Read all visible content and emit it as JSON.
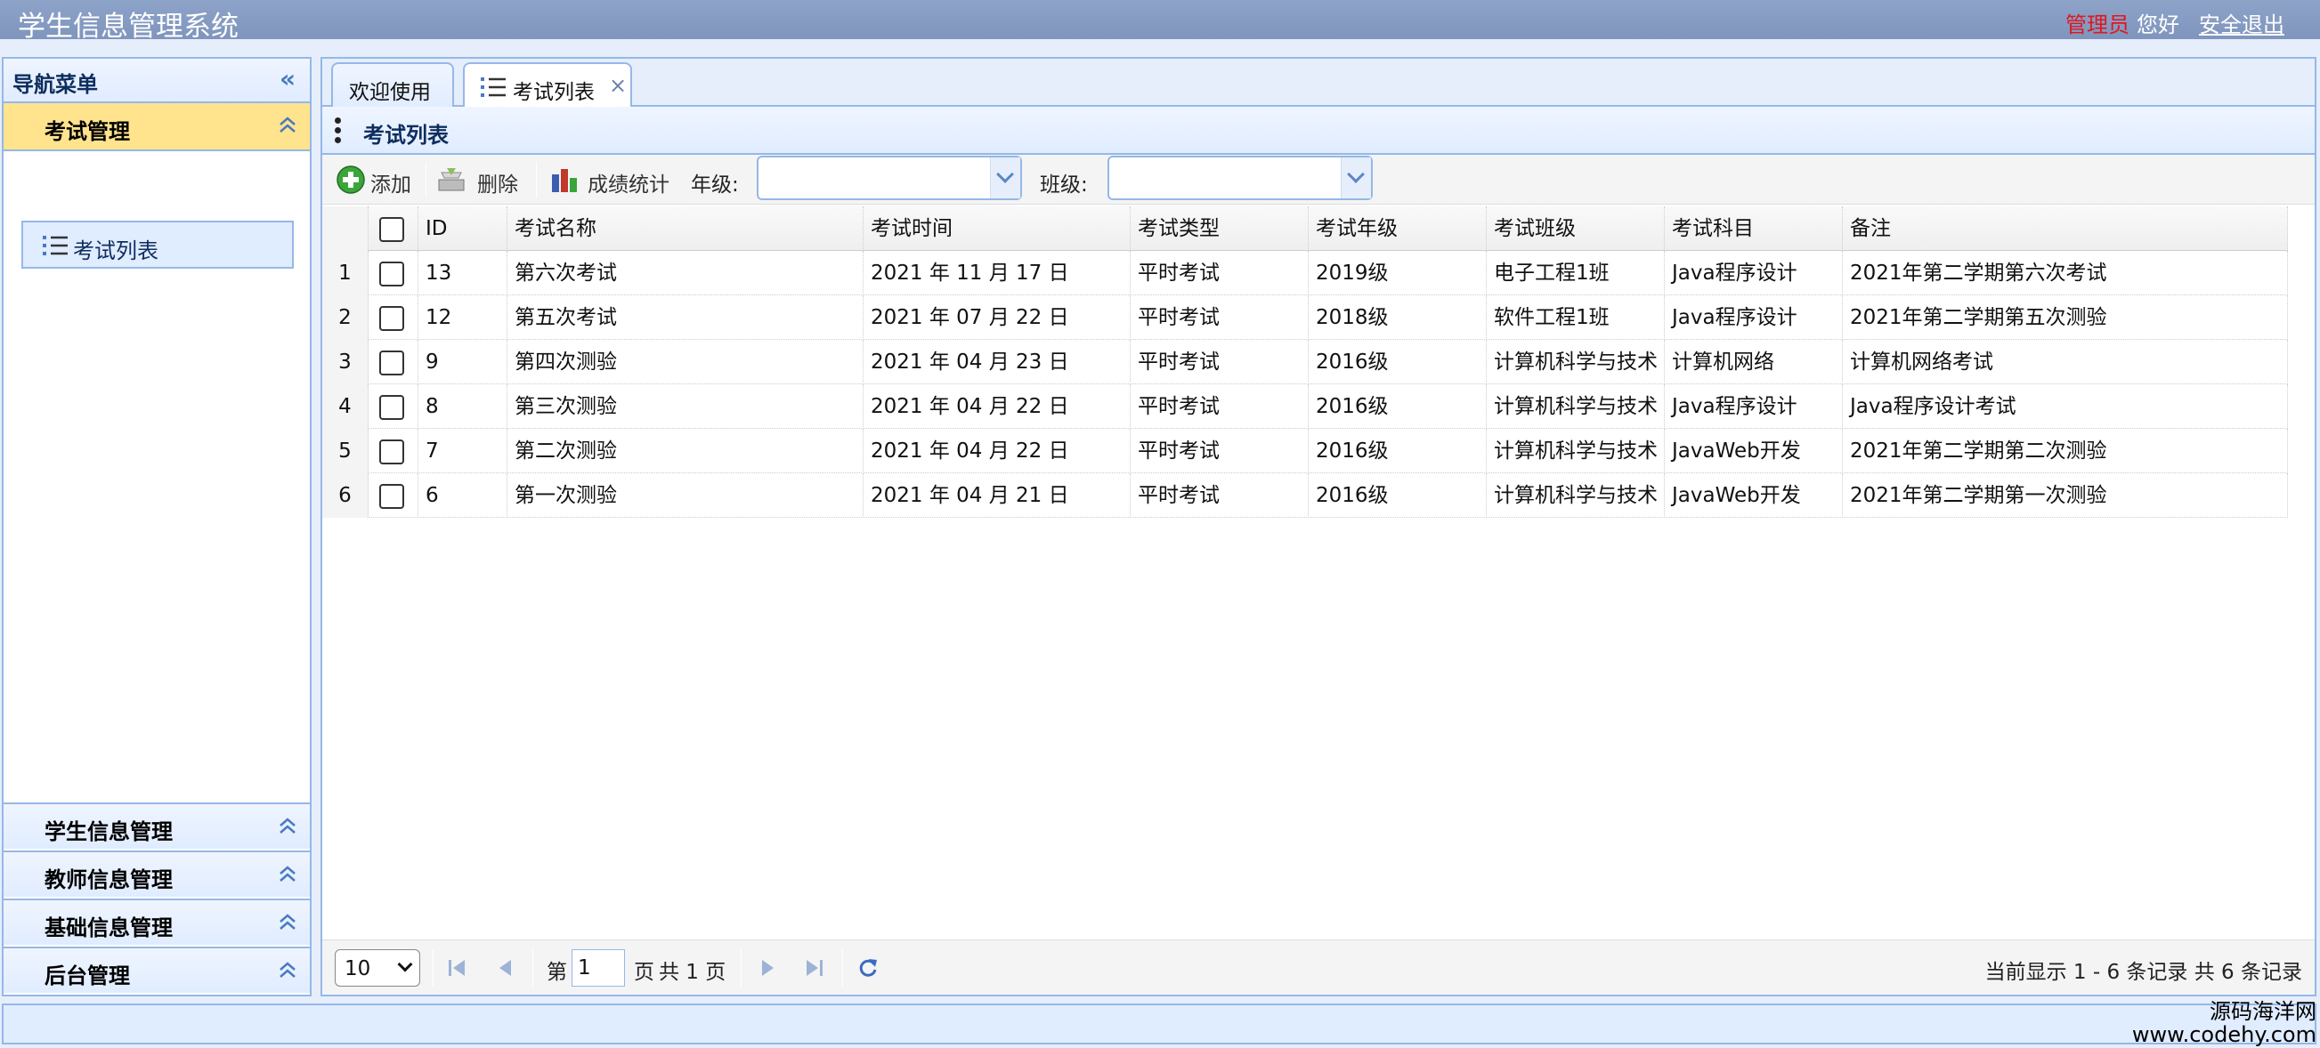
{
  "header": {
    "title": "学生信息管理系统",
    "user_role": "管理员",
    "greeting": "您好",
    "logout_label": "安全退出"
  },
  "nav": {
    "title": "导航菜单",
    "active_section": "考试管理",
    "active_items": [
      "考试列表"
    ],
    "sections": [
      "学生信息管理",
      "教师信息管理",
      "基础信息管理",
      "后台管理"
    ]
  },
  "tabs": [
    {
      "label": "欢迎使用",
      "active": false
    },
    {
      "label": "考试列表",
      "active": true,
      "closable": true,
      "close_glyph": "×"
    }
  ],
  "panel": {
    "title": "考试列表"
  },
  "toolbar": {
    "add_label": "添加",
    "delete_label": "删除",
    "stats_label": "成绩统计",
    "grade_label": "年级:",
    "class_label": "班级:",
    "grade_value": "",
    "class_value": ""
  },
  "grid": {
    "columns": [
      "ID",
      "考试名称",
      "考试时间",
      "考试类型",
      "考试年级",
      "考试班级",
      "考试科目",
      "备注"
    ],
    "rows": [
      {
        "num": "1",
        "cells": [
          "13",
          "第六次考试",
          "2021 年 11 月 17 日",
          "平时考试",
          "2019级",
          "电子工程1班",
          "Java程序设计",
          "2021年第二学期第六次考试"
        ]
      },
      {
        "num": "2",
        "cells": [
          "12",
          "第五次考试",
          "2021 年 07 月 22 日",
          "平时考试",
          "2018级",
          "软件工程1班",
          "Java程序设计",
          "2021年第二学期第五次测验"
        ]
      },
      {
        "num": "3",
        "cells": [
          "9",
          "第四次测验",
          "2021 年 04 月 23 日",
          "平时考试",
          "2016级",
          "计算机科学与技术",
          "计算机网络",
          "计算机网络考试"
        ]
      },
      {
        "num": "4",
        "cells": [
          "8",
          "第三次测验",
          "2021 年 04 月 22 日",
          "平时考试",
          "2016级",
          "计算机科学与技术",
          "Java程序设计",
          "Java程序设计考试"
        ]
      },
      {
        "num": "5",
        "cells": [
          "7",
          "第二次测验",
          "2021 年 04 月 22 日",
          "平时考试",
          "2016级",
          "计算机科学与技术",
          "JavaWeb开发",
          "2021年第二学期第二次测验"
        ]
      },
      {
        "num": "6",
        "cells": [
          "6",
          "第一次测验",
          "2021 年 04 月 21 日",
          "平时考试",
          "2016级",
          "计算机科学与技术",
          "JavaWeb开发",
          "2021年第二学期第一次测验"
        ]
      }
    ]
  },
  "pager": {
    "page_size": "10",
    "page_prefix": "第",
    "current_page": "1",
    "page_suffix": "页",
    "total_pages_text": "共 1 页",
    "info": "当前显示 1 - 6 条记录 共 6 条记录"
  },
  "watermark": {
    "line1": "源码海洋网",
    "line2": "www.codehy.com"
  },
  "colors": {
    "accent": "#95b8e7",
    "header": "#8ea3c8",
    "active_section": "#ffe48d",
    "user_role": "#e0161e"
  }
}
